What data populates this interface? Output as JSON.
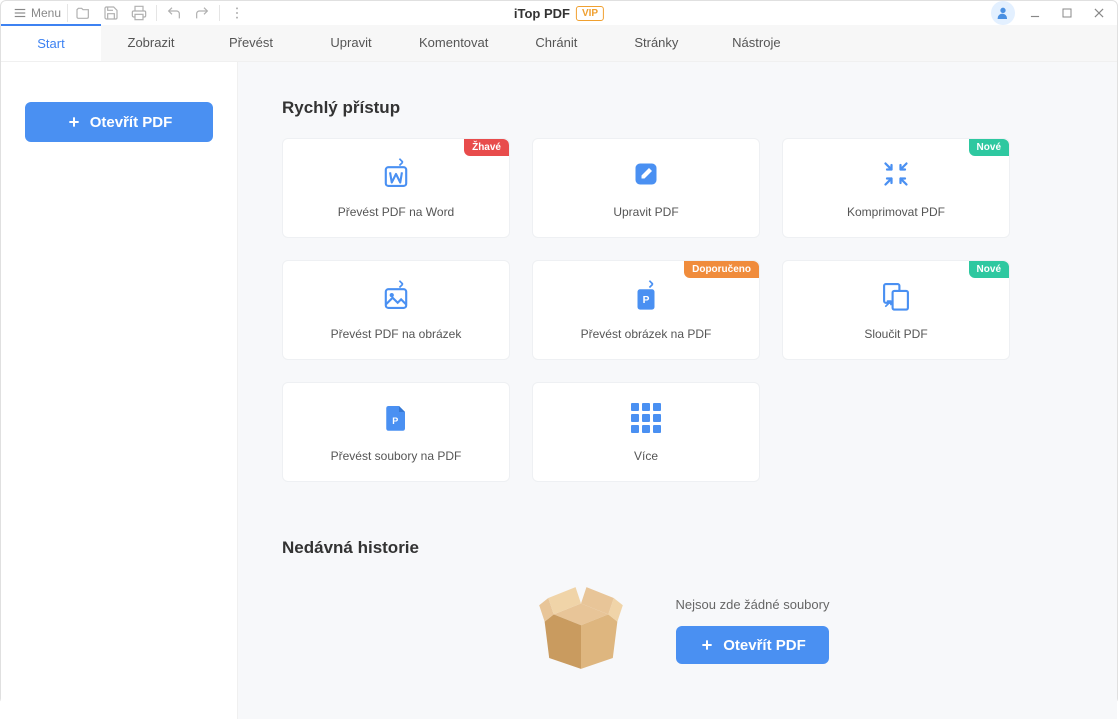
{
  "titlebar": {
    "menu_label": "Menu",
    "app_title": "iTop PDF",
    "vip_label": "VIP"
  },
  "tabs": [
    {
      "label": "Start",
      "active": true
    },
    {
      "label": "Zobrazit"
    },
    {
      "label": "Převést"
    },
    {
      "label": "Upravit"
    },
    {
      "label": "Komentovat"
    },
    {
      "label": "Chránit"
    },
    {
      "label": "Stránky"
    },
    {
      "label": "Nástroje"
    }
  ],
  "sidebar": {
    "open_label": "Otevřít PDF"
  },
  "quick_access": {
    "title": "Rychlý přístup",
    "cards": [
      {
        "label": "Převést PDF na Word",
        "badge": "Žhavé",
        "badge_class": "hot",
        "icon": "word"
      },
      {
        "label": "Upravit PDF",
        "icon": "edit"
      },
      {
        "label": "Komprimovat PDF",
        "badge": "Nové",
        "badge_class": "new",
        "icon": "compress"
      },
      {
        "label": "Převést PDF na obrázek",
        "icon": "pdf2img"
      },
      {
        "label": "Převést obrázek na PDF",
        "badge": "Doporučeno",
        "badge_class": "recommend",
        "icon": "img2pdf"
      },
      {
        "label": "Sloučit PDF",
        "badge": "Nové",
        "badge_class": "new",
        "icon": "merge"
      },
      {
        "label": "Převést soubory na PDF",
        "icon": "files2pdf"
      },
      {
        "label": "Více",
        "icon": "more"
      }
    ]
  },
  "history": {
    "title": "Nedávná historie",
    "empty_text": "Nejsou zde žádné soubory",
    "open_label": "Otevřít PDF"
  }
}
